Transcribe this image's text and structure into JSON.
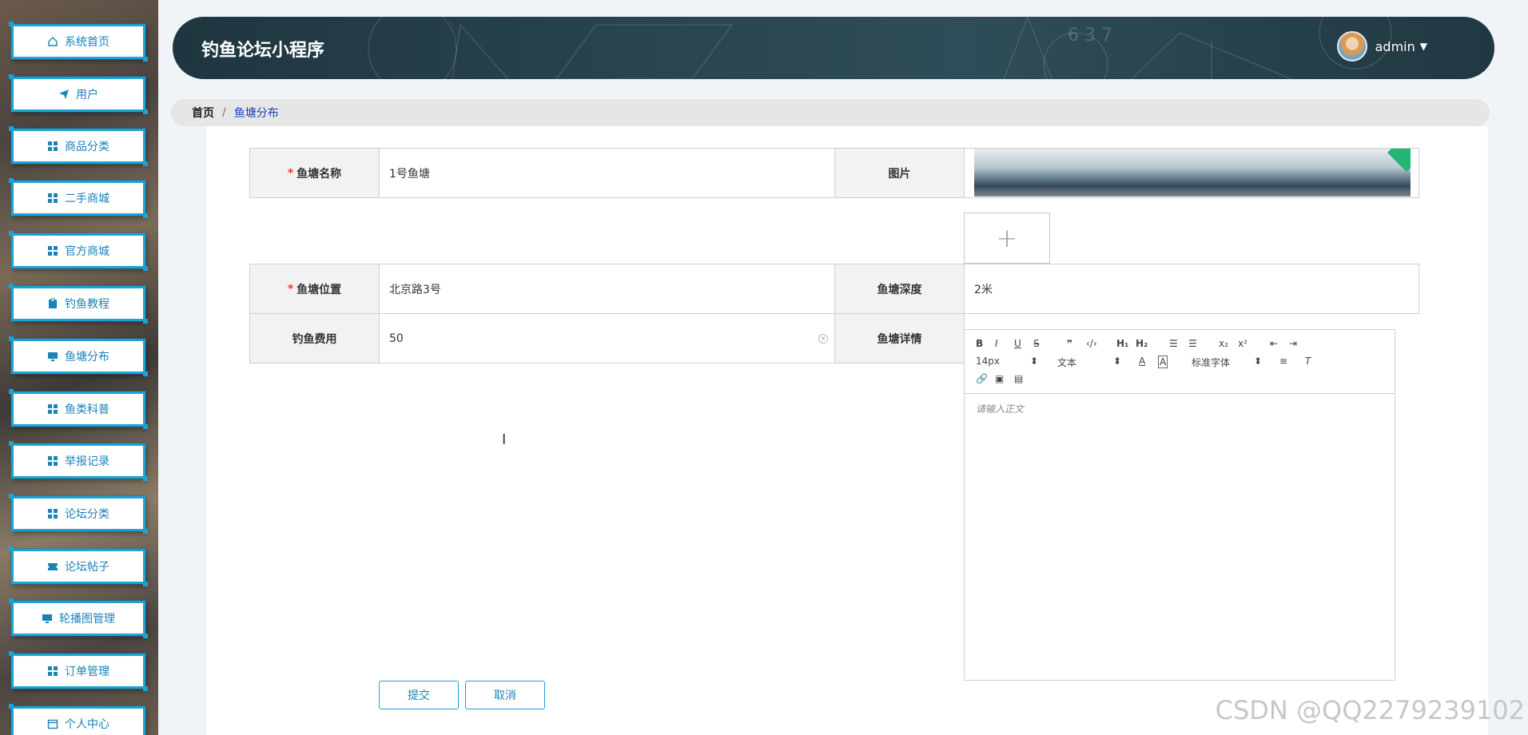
{
  "header": {
    "title": "钓鱼论坛小程序",
    "user": "admin"
  },
  "sidebar": {
    "items": [
      {
        "label": "系统首页",
        "icon": "home-icon"
      },
      {
        "label": "用户",
        "icon": "send-icon"
      },
      {
        "label": "商品分类",
        "icon": "grid-icon"
      },
      {
        "label": "二手商城",
        "icon": "grid-icon"
      },
      {
        "label": "官方商城",
        "icon": "grid-icon"
      },
      {
        "label": "钓鱼教程",
        "icon": "clipboard-icon"
      },
      {
        "label": "鱼塘分布",
        "icon": "monitor-icon"
      },
      {
        "label": "鱼类科普",
        "icon": "grid-icon"
      },
      {
        "label": "举报记录",
        "icon": "grid-icon"
      },
      {
        "label": "论坛分类",
        "icon": "grid-icon"
      },
      {
        "label": "论坛帖子",
        "icon": "ticket-icon"
      },
      {
        "label": "轮播图管理",
        "icon": "monitor-icon"
      },
      {
        "label": "订单管理",
        "icon": "grid-icon"
      },
      {
        "label": "个人中心",
        "icon": "calendar-icon"
      }
    ]
  },
  "breadcrumb": {
    "home": "首页",
    "separator": "/",
    "current": "鱼塘分布"
  },
  "form": {
    "name_label": "鱼塘名称",
    "name_value": "1号鱼塘",
    "image_label": "图片",
    "location_label": "鱼塘位置",
    "location_value": "北京路3号",
    "depth_label": "鱼塘深度",
    "depth_value": "2米",
    "fee_label": "钓鱼费用",
    "fee_value": "50",
    "detail_label": "鱼塘详情",
    "required_mark": "*",
    "upload_plus": "+"
  },
  "editor": {
    "font_size": "14px",
    "paragraph": "文本",
    "font_family": "标准字体",
    "placeholder": "请输入正文"
  },
  "buttons": {
    "submit": "提交",
    "cancel": "取消"
  },
  "watermark": "CSDN @QQ2279239102"
}
